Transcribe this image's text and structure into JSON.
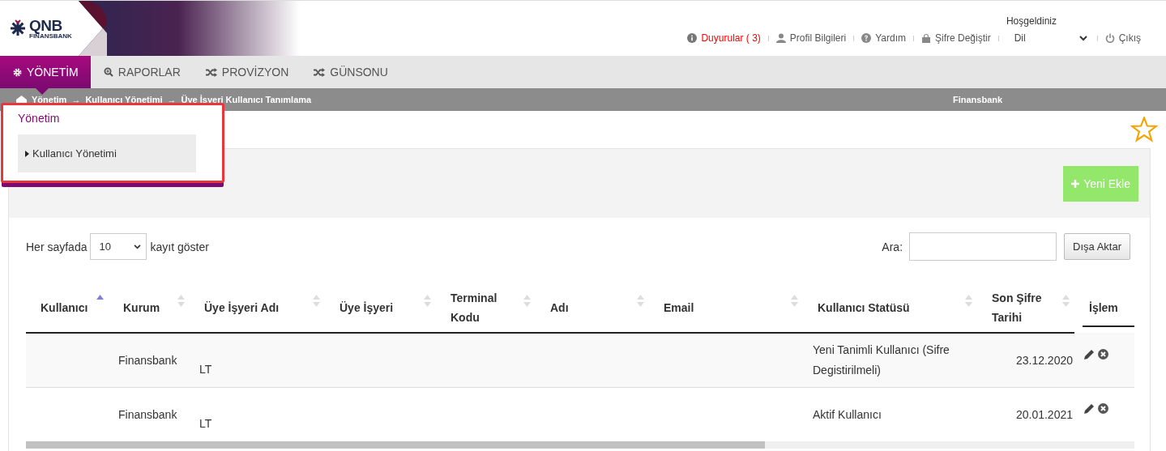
{
  "logo": {
    "name": "QNB",
    "subname": "FINANSBANK"
  },
  "header": {
    "welcome": "Hoşgeldiniz",
    "links": [
      {
        "kind": "info",
        "label": "Duyurular ( 3)",
        "alert": true
      },
      {
        "kind": "user",
        "label": "Profil Bilgileri",
        "alert": false
      },
      {
        "kind": "help",
        "label": "Yardım",
        "alert": false
      },
      {
        "kind": "lock",
        "label": "Şifre Değiştir",
        "alert": false
      }
    ],
    "language": {
      "value": "Dil"
    },
    "logout": "Çıkış"
  },
  "nav": [
    {
      "kind": "gear",
      "label": "YÖNETİM",
      "selected": true
    },
    {
      "kind": "zoom",
      "label": "RAPORLAR",
      "selected": false
    },
    {
      "kind": "shuffle",
      "label": "PROVİZYON",
      "selected": false
    },
    {
      "kind": "shuffle",
      "label": "GÜNSONU",
      "selected": false
    }
  ],
  "breadcrumb": {
    "items": [
      "Yönetim",
      "Kullanıcı Yönetimi",
      "Üye İşyeri Kullanıcı Tanımlama"
    ],
    "separator": "→",
    "institution": "Finansbank"
  },
  "dropdown": {
    "title": "Yönetim",
    "items": [
      {
        "label": "Kullanıcı Yönetimi",
        "hovered": true
      }
    ]
  },
  "favorite": {
    "on": false
  },
  "panel": {
    "add_button": "Yeni Ekle",
    "page_size": {
      "before": "Her sayfada",
      "value": "10",
      "after": "kayıt göster"
    },
    "search": {
      "label": "Ara:"
    },
    "export_button": "Dışa Aktar",
    "table": {
      "columns": [
        {
          "label": "Kullanıcı",
          "sorted": true
        },
        {
          "label": "Kurum",
          "sorted": false
        },
        {
          "label": "Üye İşyeri Adı",
          "sorted": false
        },
        {
          "label": "Üye İşyeri",
          "sorted": false
        },
        {
          "label": "Terminal Kodu",
          "sorted": false
        },
        {
          "label": "Adı",
          "sorted": false
        },
        {
          "label": "Email",
          "sorted": false
        },
        {
          "label": "Kullanıcı Statüsü",
          "sorted": false
        },
        {
          "label": "Son Şifre Tarihi",
          "sorted": false
        },
        {
          "label": "İşlem"
        }
      ],
      "rows": [
        {
          "kurum": "Finansbank",
          "merchant_name": "LT",
          "status": "Yeni Tanimli Kullanıcı (Sifre Degistirilmeli)",
          "password_date": "23.12.2020"
        },
        {
          "kurum": "Finansbank",
          "merchant_name": "LT",
          "status": "Aktif Kullanıcı",
          "password_date": "20.01.2021"
        }
      ]
    }
  }
}
